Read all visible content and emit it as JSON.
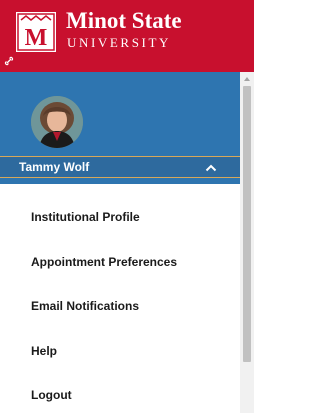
{
  "brand": {
    "name": "Minot State",
    "subtitle": "UNIVERSITY",
    "logo_letter": "M"
  },
  "profile": {
    "user_name": "Tammy Wolf"
  },
  "menu": {
    "items": [
      {
        "label": "Institutional Profile"
      },
      {
        "label": "Appointment Preferences"
      },
      {
        "label": "Email Notifications"
      },
      {
        "label": "Help"
      },
      {
        "label": "Logout"
      }
    ]
  },
  "colors": {
    "brand_red": "#c8102e",
    "profile_blue": "#2e75b0",
    "accent_gold": "#d7a85a"
  },
  "icons": {
    "logo": "minot-state-logo-icon",
    "link": "link-icon",
    "collapse": "chevron-up-icon",
    "scroll_up": "scroll-up-arrow-icon"
  }
}
